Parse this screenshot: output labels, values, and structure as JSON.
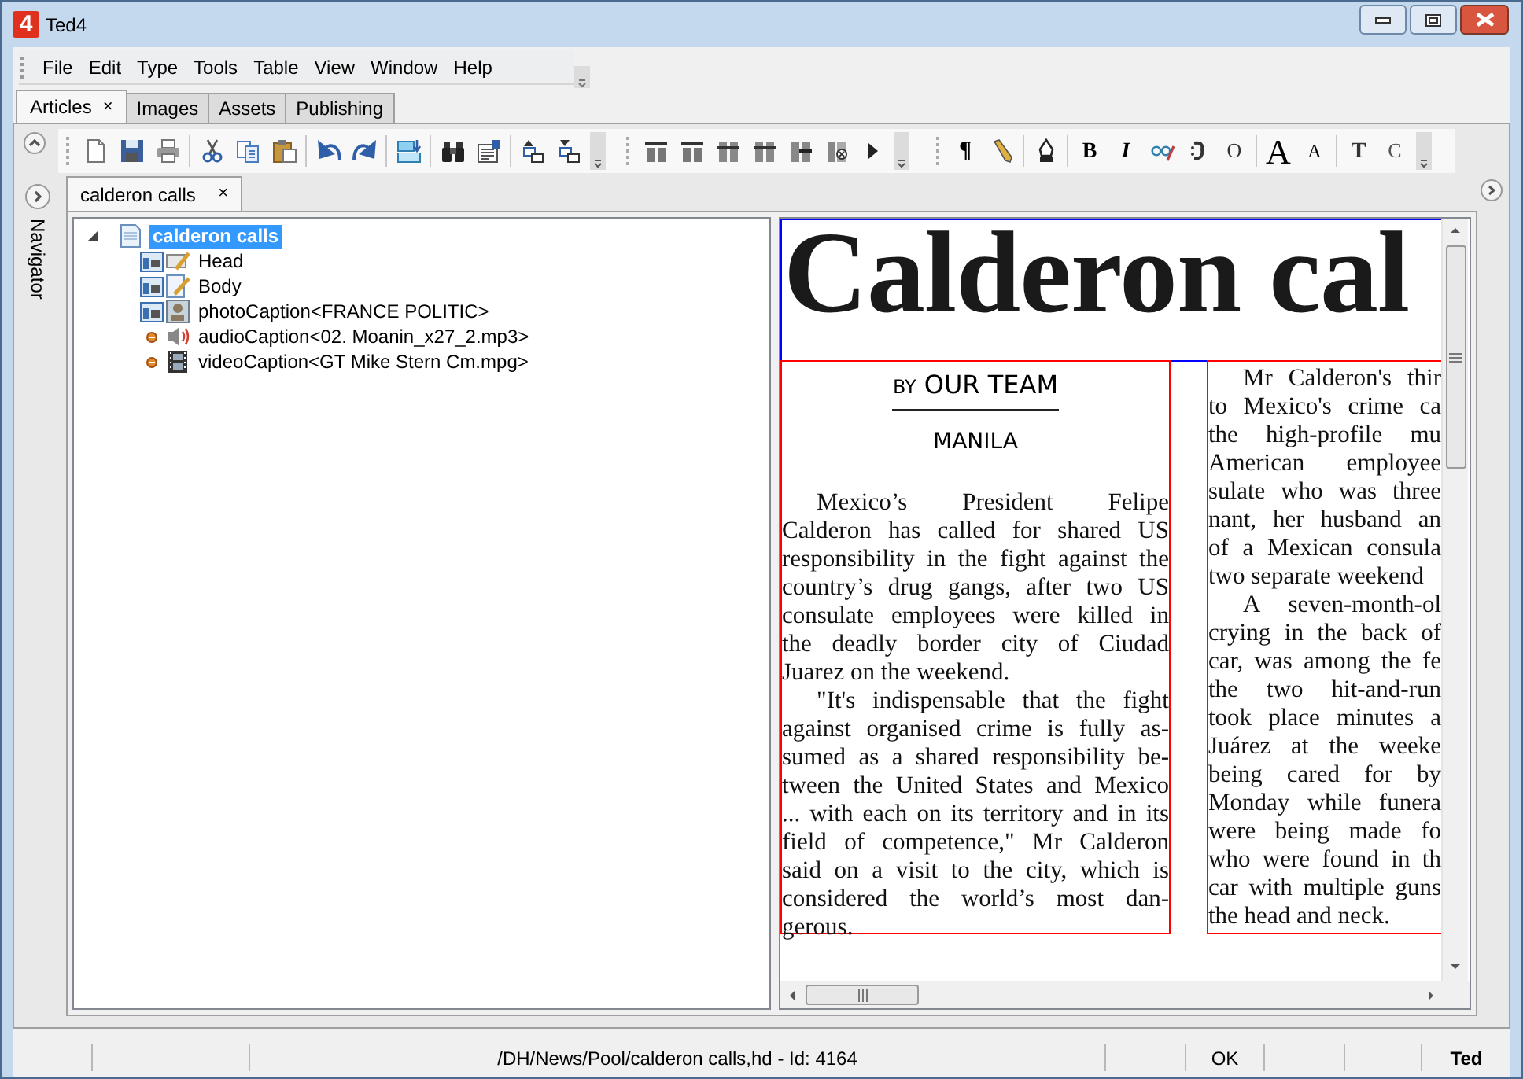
{
  "window": {
    "logo": "4",
    "title": "Ted4"
  },
  "menu": [
    "File",
    "Edit",
    "Type",
    "Tools",
    "Table",
    "View",
    "Window",
    "Help"
  ],
  "tabs": [
    {
      "label": "Articles",
      "selected": true,
      "close": "×"
    },
    {
      "label": "Images",
      "selected": false
    },
    {
      "label": "Assets",
      "selected": false
    },
    {
      "label": "Publishing",
      "selected": false
    }
  ],
  "format_glyphs": [
    "¶",
    "B",
    "I",
    "O",
    "A",
    "A",
    "T",
    "C"
  ],
  "navigator": "Navigator",
  "document_tabs": [
    {
      "label": "calderon calls",
      "selected": true,
      "close": "×"
    }
  ],
  "tree": {
    "label": "calderon calls",
    "selected": true,
    "expanded": true,
    "children": [
      {
        "kind": "head",
        "label": "Head"
      },
      {
        "kind": "body",
        "label": "Body"
      },
      {
        "kind": "photo",
        "label": "photoCaption<FRANCE POLITIC>"
      },
      {
        "kind": "audio",
        "label": "audioCaption<02. Moanin_x27_2.mp3>"
      },
      {
        "kind": "video",
        "label": "videoCaption<GT Mike Stern Cm.mpg>"
      }
    ]
  },
  "article": {
    "headline": "Calderon cal",
    "byline_prefix": "BY",
    "byline": "OUR TEAM",
    "dateline": "MANILA",
    "columns": [
      {
        "paragraphs": [
          {
            "lines": [
              "Mexico’s President Felipe",
              "Calderon has called for shared US",
              "responsibility in the fight against the",
              "country’s drug gangs, after two US",
              "consulate employees were killed in",
              "the deadly border city of Ciudad",
              "Juarez on the weekend."
            ]
          },
          {
            "lines": [
              "\"It's indispensable that the fight",
              "against organised crime is fully as-",
              "sumed as a shared responsibility be-",
              "tween the United States and Mexico",
              "... with each on its territory and in its",
              "field of competence,\" Mr Calderon",
              "said on a visit to the city, which is",
              "considered the world’s most dan-",
              "gerous."
            ]
          }
        ]
      },
      {
        "paragraphs": [
          {
            "lines": [
              "Mr Calderon's thir",
              "to Mexico's crime ca",
              "the high-profile mu",
              "American employee",
              "sulate who was three",
              "nant, her husband an",
              "of a Mexican consula",
              "two separate weekend"
            ]
          },
          {
            "lines": [
              "A seven-month-ol",
              "crying in the back of",
              "car, was among the fe",
              "the two hit-and-run",
              "took place minutes a",
              "Juárez at the weeke",
              "being cared for by",
              "Monday while funera",
              "were being made fo",
              "who were found in th",
              "car with multiple guns",
              "the head and neck."
            ]
          }
        ]
      }
    ]
  },
  "status_bar": {
    "path": "/DH/News/Pool/calderon calls,hd - Id: 4164",
    "state": "OK",
    "user": "Ted"
  }
}
